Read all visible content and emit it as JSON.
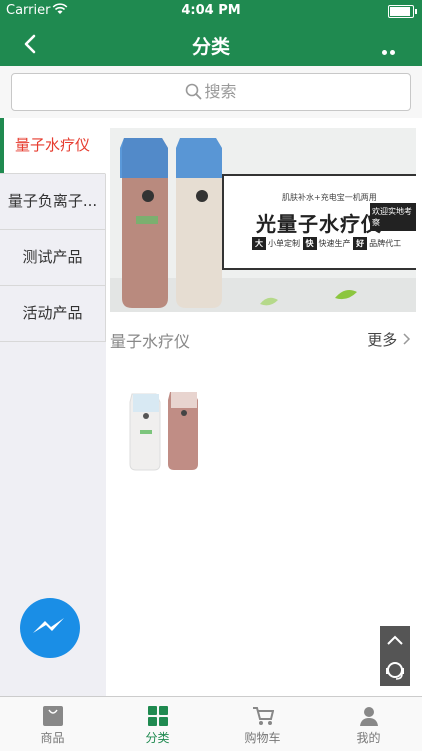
{
  "status": {
    "carrier": "Carrier",
    "time": "4:04 PM",
    "battery_level": 1.0
  },
  "nav": {
    "title": "分类"
  },
  "search": {
    "placeholder": "搜索"
  },
  "sidebar": {
    "items": [
      {
        "label": "量子水疗仪",
        "active": true
      },
      {
        "label": "量子负离子..."
      },
      {
        "label": "测试产品"
      },
      {
        "label": "活动产品"
      }
    ]
  },
  "banner": {
    "small_text": "肌肤补水+充电宝一机两用",
    "big_text": "光量子水疗仪",
    "tag": "欢迎实地考察",
    "badges": [
      {
        "mark": "大",
        "text": "小单定制"
      },
      {
        "mark": "快",
        "text": "快速生产"
      },
      {
        "mark": "好",
        "text": "品牌代工"
      }
    ]
  },
  "section": {
    "title": "量子水疗仪",
    "more": "更多"
  },
  "tabbar": {
    "items": [
      {
        "label": "商品",
        "icon": "bag-icon"
      },
      {
        "label": "分类",
        "icon": "grid-icon",
        "active": true
      },
      {
        "label": "购物车",
        "icon": "cart-icon"
      },
      {
        "label": "我的",
        "icon": "person-icon"
      }
    ]
  },
  "colors": {
    "primary": "#1f8a50",
    "active_text": "#e63b2e",
    "messenger": "#1a8ee6"
  }
}
